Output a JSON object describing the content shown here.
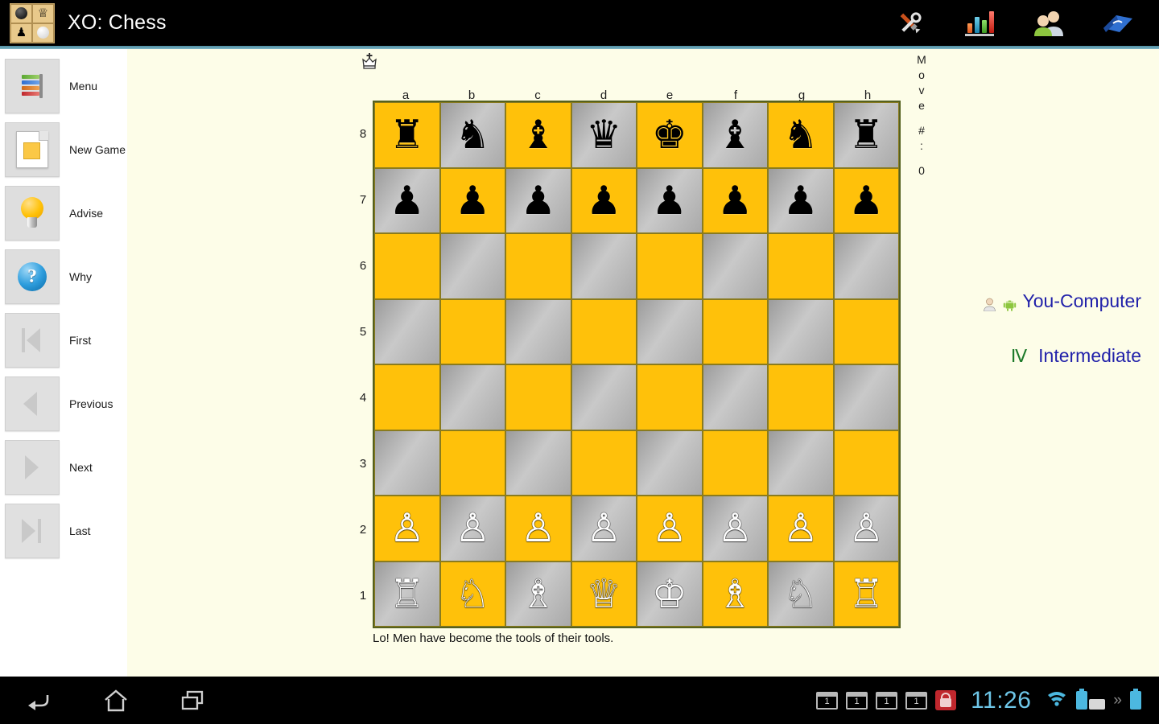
{
  "titlebar": {
    "app_title": "XO: Chess",
    "app_icon_name": "xo-chess-logo",
    "actions": [
      {
        "name": "tools-icon",
        "label": "Tools"
      },
      {
        "name": "statistics-chart-icon",
        "label": "Statistics"
      },
      {
        "name": "players-icon",
        "label": "Players"
      },
      {
        "name": "book-icon",
        "label": "Openings Book"
      }
    ]
  },
  "sidebar": {
    "items": [
      {
        "label": "Menu",
        "icon": "menu-icon",
        "enabled": true
      },
      {
        "label": "New Game",
        "icon": "new-game-icon",
        "enabled": true
      },
      {
        "label": "Advise",
        "icon": "lightbulb-icon",
        "enabled": true
      },
      {
        "label": "Why",
        "icon": "question-icon",
        "enabled": true
      },
      {
        "label": "First",
        "icon": "skip-first-icon",
        "enabled": false
      },
      {
        "label": "Previous",
        "icon": "previous-icon",
        "enabled": false
      },
      {
        "label": "Next",
        "icon": "next-icon",
        "enabled": false
      },
      {
        "label": "Last",
        "icon": "skip-last-icon",
        "enabled": false
      }
    ]
  },
  "board": {
    "turn_indicator_icon": "white-king-to-move-icon",
    "files": [
      "a",
      "b",
      "c",
      "d",
      "e",
      "f",
      "g",
      "h"
    ],
    "ranks": [
      "8",
      "7",
      "6",
      "5",
      "4",
      "3",
      "2",
      "1"
    ],
    "light_square_color": "#FFC10A",
    "dark_square_color": "#A9A9A9",
    "border_color": "#55611F",
    "position": [
      [
        "♜",
        "♞",
        "♝",
        "♛",
        "♚",
        "♝",
        "♞",
        "♜"
      ],
      [
        "♟",
        "♟",
        "♟",
        "♟",
        "♟",
        "♟",
        "♟",
        "♟"
      ],
      [
        "",
        "",
        "",
        "",
        "",
        "",
        "",
        ""
      ],
      [
        "",
        "",
        "",
        "",
        "",
        "",
        "",
        ""
      ],
      [
        "",
        "",
        "",
        "",
        "",
        "",
        "",
        ""
      ],
      [
        "",
        "",
        "",
        "",
        "",
        "",
        "",
        ""
      ],
      [
        "♙",
        "♙",
        "♙",
        "♙",
        "♙",
        "♙",
        "♙",
        "♙"
      ],
      [
        "♖",
        "♘",
        "♗",
        "♕",
        "♔",
        "♗",
        "♘",
        "♖"
      ]
    ],
    "quote": "Lo! Men have become the tools of their tools."
  },
  "right_panel": {
    "move_label_chars": [
      "M",
      "o",
      "v",
      "e"
    ],
    "move_hash": "#",
    "move_colon": ":",
    "move_number": "0",
    "players": "You-Computer",
    "player_icons": [
      "person-icon",
      "android-icon"
    ],
    "level_numeral": "Ⅳ",
    "level": "Intermediate",
    "text_color": "#2222AA",
    "numeral_color": "#1D7A2A"
  },
  "system_bar": {
    "nav": [
      {
        "name": "back-icon",
        "label": "Back"
      },
      {
        "name": "home-icon",
        "label": "Home"
      },
      {
        "name": "recent-apps-icon",
        "label": "Recent apps"
      }
    ],
    "notifications": [
      "1",
      "1",
      "1",
      "1"
    ],
    "lock_icon": "screen-lock-icon",
    "clock": "11:26",
    "wifi_icon": "wifi-icon",
    "keyboard_icon": "keyboard-icon",
    "expand_icon": "chevron-double-right-icon",
    "battery_icon": "battery-icon",
    "clock_color": "#6EC6E8"
  }
}
